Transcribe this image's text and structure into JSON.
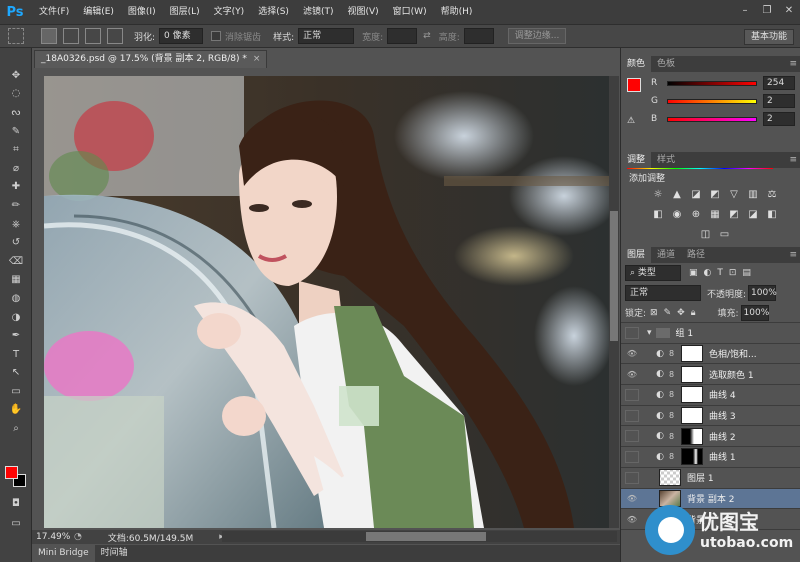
{
  "app": {
    "logo": "Ps"
  },
  "menu": [
    "文件(F)",
    "编辑(E)",
    "图像(I)",
    "图层(L)",
    "文字(Y)",
    "选择(S)",
    "滤镜(T)",
    "视图(V)",
    "窗口(W)",
    "帮助(H)"
  ],
  "window_controls": [
    "minimize-icon",
    "restore-icon",
    "close-icon"
  ],
  "options": {
    "feather_label": "羽化:",
    "feather_value": "0 像素",
    "antialias_label": "消除锯齿",
    "style_label": "样式:",
    "style_value": "正常",
    "width_label": "宽度:",
    "height_label": "高度:",
    "refine_edge": "调整边缘...",
    "workspace": "基本功能"
  },
  "document": {
    "tab_title": "_18A0326.psd @ 17.5% (背景 副本 2, RGB/8) *",
    "zoom": "17.49%",
    "doc_size": "文档:60.5M/149.5M"
  },
  "bottom_tabs": [
    "Mini Bridge",
    "时间轴"
  ],
  "tools": [
    "move-tool-icon",
    "marquee-tool-icon",
    "lasso-tool-icon",
    "quick-select-tool-icon",
    "crop-tool-icon",
    "eyedropper-tool-icon",
    "healing-brush-tool-icon",
    "brush-tool-icon",
    "clone-stamp-tool-icon",
    "history-brush-tool-icon",
    "eraser-tool-icon",
    "gradient-tool-icon",
    "blur-tool-icon",
    "dodge-tool-icon",
    "pen-tool-icon",
    "type-tool-icon",
    "path-select-tool-icon",
    "rectangle-tool-icon",
    "hand-tool-icon",
    "zoom-tool-icon"
  ],
  "colors": {
    "foreground": "#fe0202",
    "background": "#000000"
  },
  "color_panel": {
    "tabs": [
      "颜色",
      "色板"
    ],
    "sliders": [
      {
        "label": "R",
        "value": "254"
      },
      {
        "label": "G",
        "value": "2"
      },
      {
        "label": "B",
        "value": "2"
      }
    ]
  },
  "adjustments_panel": {
    "tabs": [
      "调整",
      "样式"
    ],
    "title": "添加调整",
    "icons": [
      "brightness-contrast-icon",
      "levels-icon",
      "curves-icon",
      "exposure-icon",
      "vibrance-icon",
      "hue-saturation-icon",
      "color-balance-icon",
      "black-white-icon",
      "photo-filter-icon",
      "channel-mixer-icon",
      "color-lookup-icon",
      "invert-icon",
      "posterize-icon",
      "threshold-icon",
      "selective-color-icon",
      "gradient-map-icon"
    ]
  },
  "layers_panel": {
    "tabs": [
      "图层",
      "通道",
      "路径"
    ],
    "filter": "类型",
    "blend_mode": "正常",
    "opacity_label": "不透明度:",
    "opacity": "100%",
    "lock_label": "锁定:",
    "fill_label": "填充:",
    "fill": "100%",
    "layers": [
      {
        "name": "组 1",
        "visible": false,
        "kind": "group"
      },
      {
        "name": "色相/饱和...",
        "visible": true,
        "kind": "adjust"
      },
      {
        "name": "选取颜色 1",
        "visible": true,
        "kind": "adjust"
      },
      {
        "name": "曲线 4",
        "visible": false,
        "kind": "curve"
      },
      {
        "name": "曲线 3",
        "visible": false,
        "kind": "curve"
      },
      {
        "name": "曲线 2",
        "visible": false,
        "kind": "curve-mask"
      },
      {
        "name": "曲线 1",
        "visible": false,
        "kind": "curve-mask2"
      },
      {
        "name": "图层 1",
        "visible": false,
        "kind": "pixel"
      },
      {
        "name": "背景 副本 2",
        "visible": true,
        "kind": "photo",
        "selected": true
      },
      {
        "name": "背景",
        "visible": true,
        "kind": "photo"
      }
    ]
  },
  "watermark": {
    "title": "优图宝",
    "subtitle": "utobao.com"
  }
}
